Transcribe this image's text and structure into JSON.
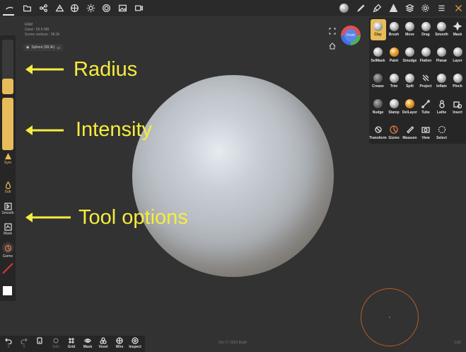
{
  "info": {
    "ram_label": "RAM",
    "used": "Used : 69.9 MB",
    "scene_vertices": "Scene vertices : 98.3k",
    "mesh_chip": "Sphere (98.3k)",
    "mesh_chip_tag": "vv"
  },
  "gizmo": {
    "face_label": "Front"
  },
  "left_bar": {
    "radius_fraction": 0.28,
    "intensity_fraction": 1.0,
    "sym": "Sym",
    "sub": "Sub",
    "smooth": "Smooth",
    "mask": "Mask",
    "gizmo": "Gizmo"
  },
  "annotations": {
    "radius": "Radius",
    "intensity": "Intensity",
    "tool_options": "Tool options"
  },
  "tools": [
    {
      "label": "Clay",
      "icon": "clay-ball-icon",
      "selected": true
    },
    {
      "label": "Brush",
      "icon": "brush-ball-icon"
    },
    {
      "label": "Move",
      "icon": "move-ball-icon"
    },
    {
      "label": "Drag",
      "icon": "drag-ball-icon"
    },
    {
      "label": "Smooth",
      "icon": "smooth-ball-icon"
    },
    {
      "label": "Mask",
      "icon": "mask-icon"
    },
    {
      "label": "SelMask",
      "icon": "selmask-ball-icon"
    },
    {
      "label": "Paint",
      "icon": "paint-ball-icon"
    },
    {
      "label": "Smudge",
      "icon": "smudge-ball-icon"
    },
    {
      "label": "Flatten",
      "icon": "flatten-ball-icon"
    },
    {
      "label": "Planar",
      "icon": "planar-ball-icon"
    },
    {
      "label": "Layer",
      "icon": "layer-ball-icon"
    },
    {
      "label": "Crease",
      "icon": "crease-ball-icon"
    },
    {
      "label": "Trim",
      "icon": "trim-ball-icon"
    },
    {
      "label": "Split",
      "icon": "split-ball-icon"
    },
    {
      "label": "Project",
      "icon": "project-icon"
    },
    {
      "label": "Inflate",
      "icon": "inflate-ball-icon"
    },
    {
      "label": "Pinch",
      "icon": "pinch-ball-icon"
    },
    {
      "label": "Nudge",
      "icon": "nudge-ball-icon"
    },
    {
      "label": "Stamp",
      "icon": "stamp-ball-icon"
    },
    {
      "label": "DelLayer",
      "icon": "dellayer-ball-icon"
    },
    {
      "label": "Tube",
      "icon": "tube-icon"
    },
    {
      "label": "Lathe",
      "icon": "lathe-icon"
    },
    {
      "label": "Insert",
      "icon": "insert-icon"
    },
    {
      "label": "Transform",
      "icon": "transform-icon"
    },
    {
      "label": "Gizmo",
      "icon": "gizmo-icon"
    },
    {
      "label": "Measure",
      "icon": "measure-icon"
    },
    {
      "label": "View",
      "icon": "camera-icon"
    },
    {
      "label": "Select",
      "icon": "select-icon"
    }
  ],
  "bottom_bar": {
    "undo": "0",
    "redo": "0",
    "solo": "Solo",
    "grid": "Grid",
    "mask": "Mask",
    "voxel": "Voxel",
    "wire": "Wire",
    "inspect": "Inspect"
  },
  "status": {
    "build": "Oct 17 2023 Build",
    "version": "1.83"
  }
}
